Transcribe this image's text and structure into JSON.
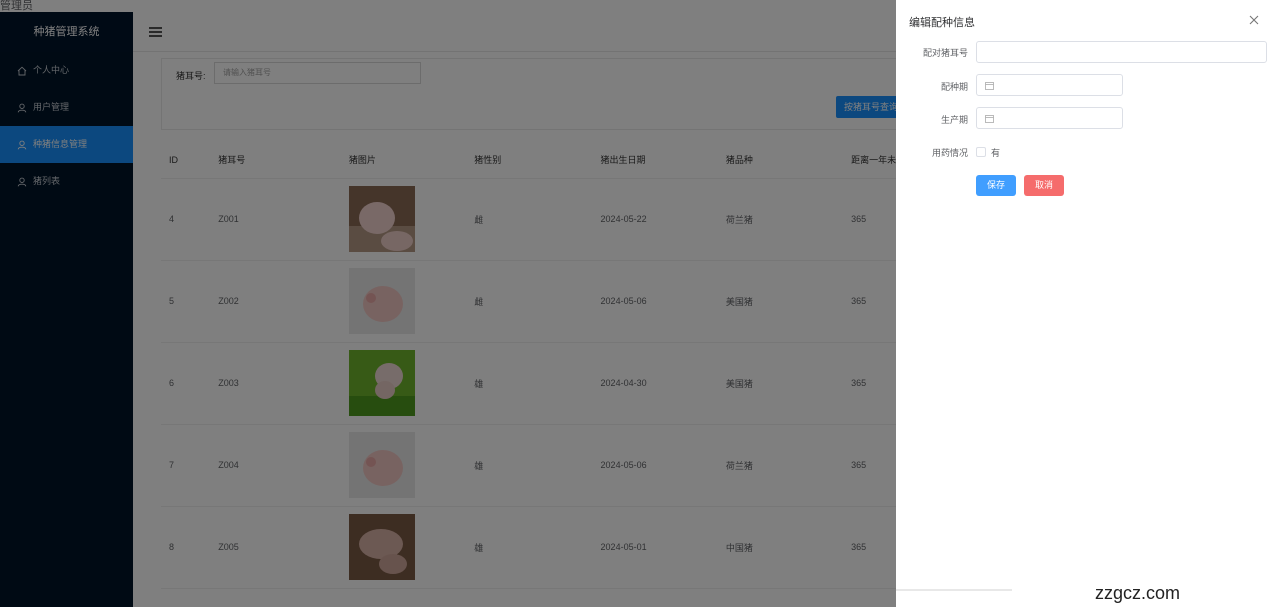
{
  "header": {
    "role": "管理员"
  },
  "sidebar": {
    "title": "种猪管理系统",
    "items": [
      {
        "label": "个人中心",
        "icon": "home-icon",
        "active": false
      },
      {
        "label": "用户管理",
        "icon": "user-icon",
        "active": false
      },
      {
        "label": "种猪信息管理",
        "icon": "user-icon",
        "active": true
      },
      {
        "label": "猪列表",
        "icon": "user-icon",
        "active": false
      }
    ]
  },
  "search": {
    "label": "猪耳号:",
    "placeholder": "请输入猪耳号",
    "button": "按猪耳号查询"
  },
  "table": {
    "columns": [
      "ID",
      "猪耳号",
      "猪图片",
      "猪性别",
      "猪出生日期",
      "猪品种",
      "距离一年未生产剩余天数"
    ],
    "rows": [
      {
        "id": "4",
        "ear": "Z001",
        "sex": "雌",
        "birth": "2024-05-22",
        "breed": "荷兰猪",
        "days": "365"
      },
      {
        "id": "5",
        "ear": "Z002",
        "sex": "雌",
        "birth": "2024-05-06",
        "breed": "美国猪",
        "days": "365"
      },
      {
        "id": "6",
        "ear": "Z003",
        "sex": "雄",
        "birth": "2024-04-30",
        "breed": "美国猪",
        "days": "365"
      },
      {
        "id": "7",
        "ear": "Z004",
        "sex": "雄",
        "birth": "2024-05-06",
        "breed": "荷兰猪",
        "days": "365"
      },
      {
        "id": "8",
        "ear": "Z005",
        "sex": "雄",
        "birth": "2024-05-01",
        "breed": "中国猪",
        "days": "365"
      }
    ]
  },
  "drawer": {
    "title": "编辑配种信息",
    "fields": {
      "pair_ear": {
        "label": "配对猪耳号",
        "value": ""
      },
      "breeding": {
        "label": "配种期",
        "value": ""
      },
      "production": {
        "label": "生产期",
        "value": ""
      },
      "medication": {
        "label": "用药情况",
        "option": "有",
        "checked": false
      }
    },
    "save": "保存",
    "cancel": "取消"
  },
  "watermark": "zzgcz.com"
}
